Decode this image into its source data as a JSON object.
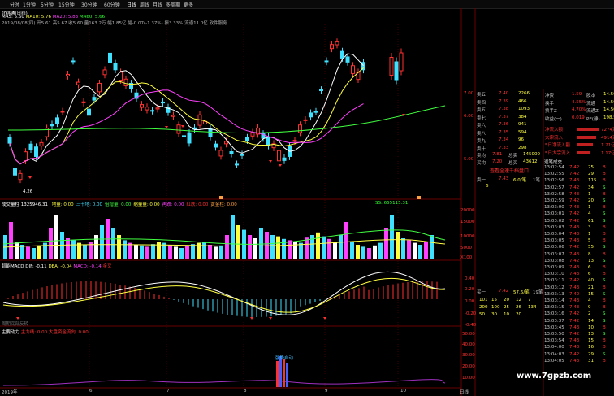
{
  "toolbar": {
    "tabs": [
      "分时",
      "1分钟",
      "5分钟",
      "15分钟",
      "30分钟",
      "60分钟",
      "日线",
      "周线",
      "月线",
      "多周期",
      "更多"
    ],
    "active": "日线"
  },
  "main_chart": {
    "title": "北纬通(日线)",
    "ma_line": {
      "ma5": "MA5: 5.60",
      "ma10": "MA10: 5.76",
      "ma20": "MA20: 5.83",
      "ma60": "MA60: 5.66"
    },
    "info_line": "2019/08/08(四) 开5.61 高5.67 收5.60 量163.2万 幅1.85亿 幅-0.07(-1.37%) 振3.33% 流通11.0亿 软件服务",
    "low_label": "4.26",
    "y_ticks": [
      "7.00",
      "6.00",
      "5.00"
    ]
  },
  "volume_panel": {
    "header": "成交量柱 1325946.31",
    "legend": [
      "地量: 0.00",
      "三十地: 0.00",
      "倍增量: 0.00",
      "缩量量: 0.00",
      "再跌: 0.00",
      "红跌: 0.00",
      "黄金柱: 0.00"
    ],
    "right_label": "SS: 655115.31",
    "y_ticks": [
      "20000",
      "15000",
      "10000",
      "5000",
      "X100"
    ]
  },
  "macd_panel": {
    "header": "智能MACD",
    "dif": "DIF: -0.11",
    "dea": "DEA: -0.04",
    "macd": "MACD: -0.14",
    "tag": "金叉",
    "y_ticks": [
      "0.40",
      "0.20",
      "0.00",
      "-0.20",
      "-0.40"
    ],
    "foot_label": "周期底部反转"
  },
  "force_panel": {
    "header": "主要动力",
    "main": "主力线: 0.00",
    "avg": "大盘资金流向: 0.00",
    "spike_label": "强势启动",
    "y_ticks": [
      "50.00",
      "40.00",
      "30.00",
      "20.00",
      "10.00"
    ]
  },
  "x_axis": [
    "2019年",
    "6",
    "7",
    "8",
    "9",
    "10",
    "日线"
  ],
  "order_book": {
    "asks": [
      {
        "label": "卖五",
        "price": "7.40",
        "vol": "2266"
      },
      {
        "label": "卖四",
        "price": "7.39",
        "vol": "466"
      },
      {
        "label": "卖五",
        "price": "7.38",
        "vol": "1093"
      },
      {
        "label": "卖七",
        "price": "7.37",
        "vol": "384"
      },
      {
        "label": "卖六",
        "price": "7.36",
        "vol": "941"
      },
      {
        "label": "卖八",
        "price": "7.35",
        "vol": "594"
      },
      {
        "label": "卖九",
        "price": "7.34",
        "vol": "96"
      },
      {
        "label": "卖十",
        "price": "7.33",
        "vol": "298"
      }
    ],
    "sum_rows": [
      {
        "label": "卖均",
        "price": "7.81",
        "extra": "总卖",
        "vol": "145000"
      },
      {
        "label": "买均",
        "price": "7.20",
        "extra": "总买",
        "vol": "43612"
      }
    ]
  },
  "mid_panel": {
    "title": "查看全速千档盘口",
    "row1": {
      "l": "卖一",
      "p": "7.43",
      "v": "6.0/笔",
      "n": "1笔"
    },
    "row1_sub": "6",
    "row2": {
      "l": "买一",
      "p": "7.42",
      "v": "57.6/笔",
      "n": "19笔"
    },
    "grid": [
      [
        "101",
        "15",
        "20",
        "12",
        "7"
      ],
      [
        "200",
        "100",
        "25",
        "26",
        "134"
      ],
      [
        "50",
        "30",
        "10",
        "20",
        ""
      ]
    ]
  },
  "stats": {
    "rows": [
      {
        "k": "净资",
        "v": "1.59",
        "k2": "股本",
        "v2": "14.50"
      },
      {
        "k": "换手",
        "v": "4.55%",
        "k2": "流通",
        "v2": "14.50"
      },
      {
        "k": "换手Z",
        "v": "4.70%",
        "k2": "流通Z",
        "v2": "14.50"
      },
      {
        "k": "收益(一)",
        "v": "0.019",
        "k2": "PE(静)",
        "v2": "198.5"
      }
    ],
    "flows": [
      {
        "k": "净流入额",
        "v": "7274万"
      },
      {
        "k": "大宗流入",
        "v": "4914万"
      },
      {
        "k": "5日净流入额",
        "v": "1.21亿"
      },
      {
        "k": "5日大宗流入",
        "v": "1.17亿"
      }
    ],
    "flow_title": "逐笔成交"
  },
  "ticks": [
    [
      "13:02:54",
      "7.42",
      "25",
      "B"
    ],
    [
      "13:02:55",
      "7.42",
      "29",
      "B"
    ],
    [
      "13:02:56",
      "7.43",
      "115",
      "B"
    ],
    [
      "13:02:57",
      "7.42",
      "34",
      "S"
    ],
    [
      "13:02:58",
      "7.43",
      "1",
      "B"
    ],
    [
      "13:02:59",
      "7.42",
      "20",
      "S"
    ],
    [
      "13:03:00",
      "7.43",
      "1",
      "B"
    ],
    [
      "13:03:01",
      "7.42",
      "4",
      "S"
    ],
    [
      "13:03:02",
      "7.42",
      "61",
      "S"
    ],
    [
      "13:03:03",
      "7.43",
      "3",
      "B"
    ],
    [
      "13:03:04",
      "7.43",
      "1",
      "B"
    ],
    [
      "13:03:05",
      "7.43",
      "5",
      "B"
    ],
    [
      "13:03:06",
      "7.42",
      "55",
      "S"
    ],
    [
      "13:03:07",
      "7.43",
      "8",
      "B"
    ],
    [
      "13:03:08",
      "7.42",
      "13",
      "S"
    ],
    [
      "13:03:09",
      "7.43",
      "6",
      "B"
    ],
    [
      "13:03:10",
      "7.43",
      "6",
      "B"
    ],
    [
      "13:03:11",
      "7.42",
      "40",
      "S"
    ],
    [
      "13:03:12",
      "7.43",
      "21",
      "B"
    ],
    [
      "13:03:13",
      "7.42",
      "15",
      "S"
    ],
    [
      "13:03:14",
      "7.43",
      "4",
      "B"
    ],
    [
      "13:03:15",
      "7.43",
      "9",
      "B"
    ],
    [
      "13:03:16",
      "7.42",
      "2",
      "S"
    ],
    [
      "13:03:37",
      "7.42",
      "14",
      "S"
    ],
    [
      "13:03:45",
      "7.43",
      "10",
      "B"
    ],
    [
      "13:03:50",
      "7.42",
      "13",
      "S"
    ],
    [
      "13:03:54",
      "7.43",
      "15",
      "B"
    ],
    [
      "13:04:00",
      "7.43",
      "16",
      "B"
    ],
    [
      "13:04:03",
      "7.42",
      "29",
      "S"
    ],
    [
      "13:04:05",
      "7.43",
      "31",
      "B"
    ]
  ],
  "watermark": "www.7gpzb.com"
}
